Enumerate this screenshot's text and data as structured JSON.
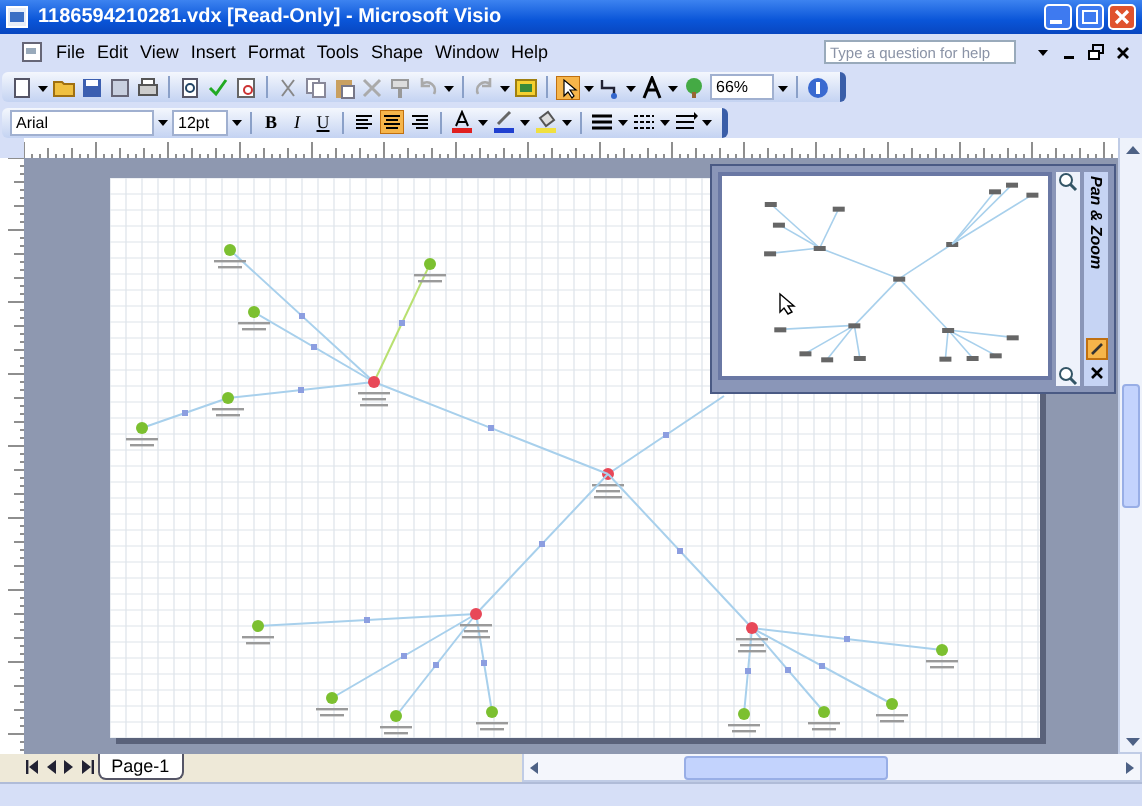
{
  "window": {
    "title": "1186594210281.vdx [Read-Only] - Microsoft Visio"
  },
  "menu": [
    "File",
    "Edit",
    "View",
    "Insert",
    "Format",
    "Tools",
    "Shape",
    "Window",
    "Help"
  ],
  "help_box": {
    "placeholder": "Type a question for help"
  },
  "formatting": {
    "font": "Arial",
    "size": "12pt",
    "zoom": "66%",
    "bold": "B",
    "italic": "I",
    "underline": "U"
  },
  "pan_zoom": {
    "title": "Pan & Zoom"
  },
  "page_tabs": [
    {
      "label": "Page-1",
      "selected": true
    }
  ]
}
